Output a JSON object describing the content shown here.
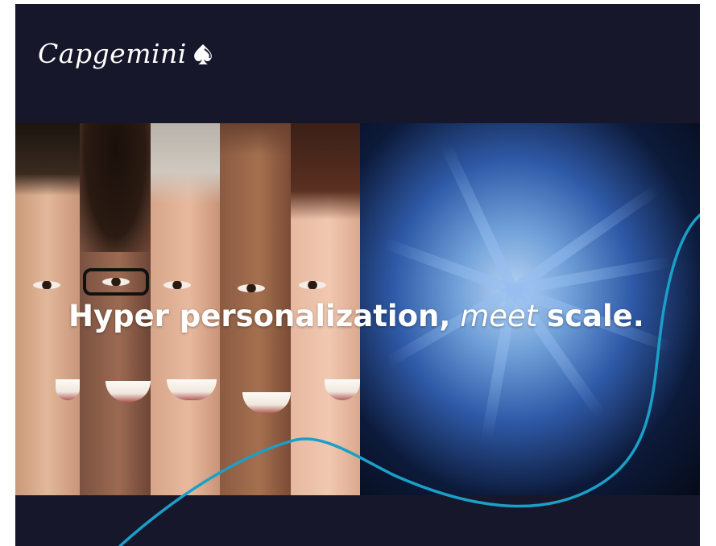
{
  "brand": {
    "name": "Capgemini",
    "icon": "spade-logo-icon"
  },
  "headline": {
    "part1": "Hyper personalization,",
    "part2": "meet",
    "part3": "scale."
  },
  "colors": {
    "background": "#17172b",
    "accent_line": "#1aa0c8",
    "text": "#ffffff"
  }
}
